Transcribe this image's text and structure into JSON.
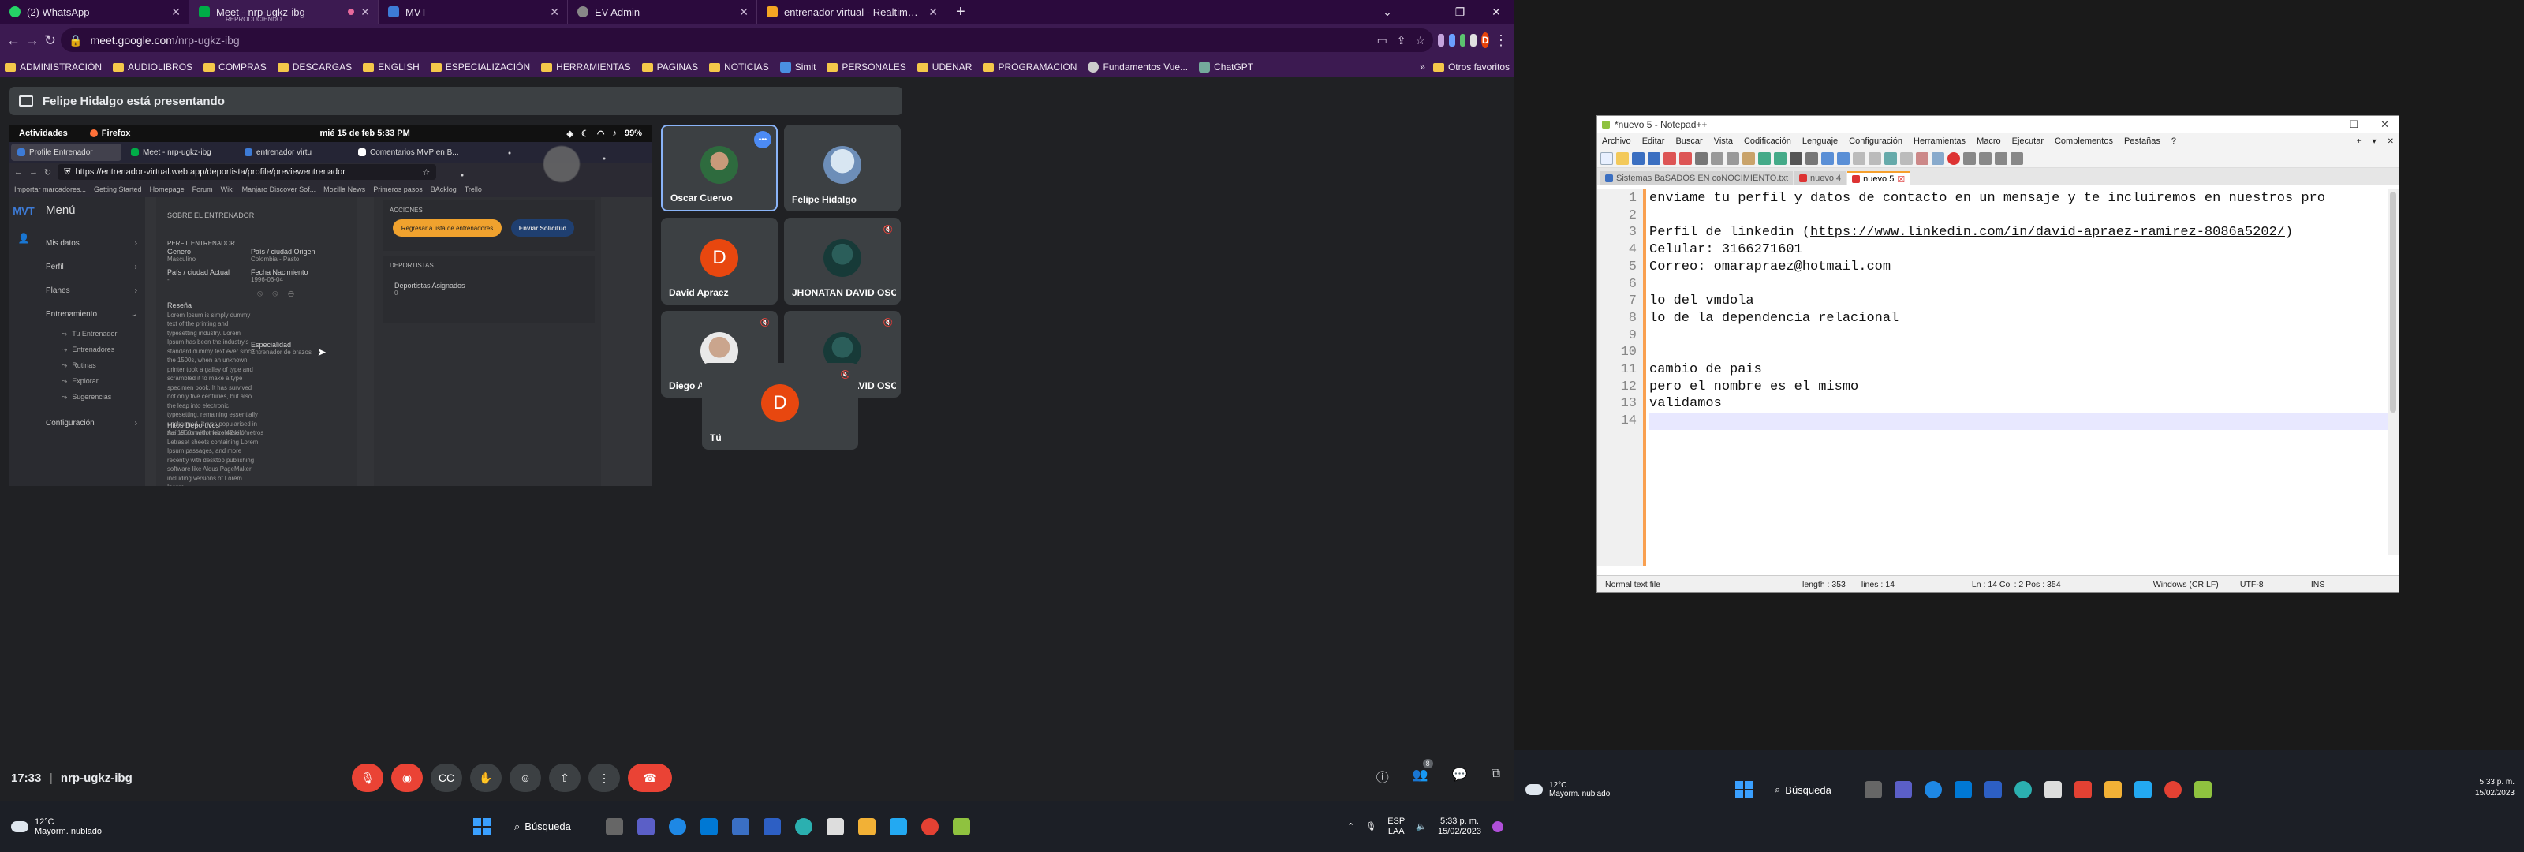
{
  "browser": {
    "tabs": [
      {
        "label": "(2) WhatsApp",
        "color": "#25d366"
      },
      {
        "label": "Meet - nrp-ugkz-ibg",
        "sublabel": "REPRODUCIENDO",
        "color": "#00ac47",
        "active": true
      },
      {
        "label": "MVT",
        "color": "#3d7bd6"
      },
      {
        "label": "EV Admin",
        "color": "#999999"
      },
      {
        "label": "entrenador virtual - Realtime Da",
        "color": "#f5a623"
      }
    ],
    "url": "meet.google.com",
    "url_path": "/nrp-ugkz-ibg",
    "bookmarks": [
      "ADMINISTRACIÓN",
      "AUDIOLIBROS",
      "COMPRAS",
      "DESCARGAS",
      "ENGLISH",
      "ESPECIALIZACIÓN",
      "HERRAMIENTAS",
      "PAGINAS",
      "NOTICIAS",
      "Simit",
      "PERSONALES",
      "UDENAR",
      "PROGRAMACION",
      "Fundamentos Vue...",
      "ChatGPT"
    ],
    "bookmarks_more": "»",
    "other_bookmarks": "Otros favoritos",
    "profile_initial": "D"
  },
  "meet": {
    "presenting": "Felipe Hidalgo está presentando",
    "time": "17:33",
    "code": "nrp-ugkz-ibg",
    "people_count": "8",
    "participants": [
      {
        "name": "Oscar Cuervo",
        "type": "photo",
        "speaking": true
      },
      {
        "name": "Felipe Hidalgo",
        "type": "photo"
      },
      {
        "name": "David Apraez",
        "type": "letter",
        "letter": "D"
      },
      {
        "name": "JHONATAN DAVID OSORIO LI...",
        "type": "photo",
        "muted": true
      },
      {
        "name": "Diego Agreda",
        "type": "photo",
        "muted": true
      },
      {
        "name": "JHONATAN DAVID OSORIO LI...",
        "type": "photo",
        "muted": true
      },
      {
        "name": "Tú",
        "type": "letter",
        "letter": "D",
        "muted": true
      }
    ]
  },
  "shared": {
    "activities": "Actividades",
    "firefox": "Firefox",
    "clock": "mié 15 de feb  5:33 PM",
    "battery": "99%",
    "tabs": [
      "Profile Entrenador",
      "Meet - nrp-ugkz-ibg",
      "entrenador virtu",
      "Comentarios MVP en B..."
    ],
    "url": "https://entrenador-virtual.web.app/deportista/profile/previewentrenador",
    "bookmarks": [
      "Importar marcadores...",
      "Getting Started",
      "Homepage",
      "Forum",
      "Wiki",
      "Manjaro Discover Sof...",
      "Mozilla News",
      "Primeros pasos",
      "BAcklog",
      "Trello"
    ],
    "app": {
      "logo": "MVT",
      "menu_title": "Menú",
      "menu": [
        "Mis datos",
        "Perfil",
        "Planes"
      ],
      "training": "Entrenamiento",
      "training_sub": [
        "Tu Entrenador",
        "Entrenadores",
        "Rutinas",
        "Explorar",
        "Sugerencias"
      ],
      "config": "Configuración",
      "about": "SOBRE EL ENTRENADOR",
      "profile_h": "PERFIL ENTRENADOR",
      "genero_k": "Genero",
      "genero_v": "Masculino",
      "pais_origen_k": "País / ciudad Origen",
      "pais_origen_v": "Colombia - Pasto",
      "pais_actual_k": "País / ciudad Actual",
      "pais_actual_v": "-",
      "fecha_k": "Fecha Nacimiento",
      "fecha_v": "1996-06-04",
      "resena_k": "Reseña",
      "resena_v": "Lorem Ipsum is simply dummy text of the printing and typesetting industry. Lorem Ipsum has been the industry's standard dummy text ever since the 1500s, when an unknown printer took a galley of type and scrambled it to make a type specimen book. It has survived not only five centuries, but also the leap into electronic typesetting, remaining essentially unchanged. It was popularised in the 1960s with the release of Letraset sheets containing Lorem Ipsum passages, and more recently with desktop publishing software like Aldus PageMaker including versions of Lorem Ipsum",
      "especialidad_k": "Especialidad",
      "especialidad_v": "Entrenador de brazos",
      "hitos_k": "Hitos Deportivos",
      "hitos_v": "Así, el comedor hizo 42 kilómetros",
      "acciones": "ACCIONES",
      "btn_return": "Regresar a lista de entrenadores",
      "btn_send": "Enviar Solicitud",
      "deportistas": "DEPORTISTAS",
      "asignados_k": "Deportistas Asignados",
      "asignados_v": "0"
    }
  },
  "taskbar_left": {
    "temp": "12°C",
    "weather": "Mayorm. nublado",
    "search": "Búsqueda",
    "lang1": "ESP",
    "lang2": "LAA",
    "time": "5:33 p. m.",
    "date": "15/02/2023"
  },
  "notepad": {
    "title": "*nuevo 5 - Notepad++",
    "menu": [
      "Archivo",
      "Editar",
      "Buscar",
      "Vista",
      "Codificación",
      "Lenguaje",
      "Configuración",
      "Herramientas",
      "Macro",
      "Ejecutar",
      "Complementos",
      "Pestañas",
      "?"
    ],
    "tabs": [
      "Sistemas BaSADOS EN coNOCIMIENTO.txt",
      "nuevo 4",
      "nuevo 5"
    ],
    "lines": [
      "enviame tu perfil y datos de contacto en un mensaje y te incluiremos en nuestros pro",
      "",
      "Perfil de linkedin (https://www.linkedin.com/in/david-apraez-ramirez-8086a5202/)",
      "Celular: 3166271601",
      "Correo: omarapraez@hotmail.com",
      "",
      "lo del vmdola",
      "lo de la dependencia relacional",
      "",
      "",
      "cambio de pais",
      "pero el nombre es el mismo",
      "validamos",
      ""
    ],
    "status": {
      "type": "Normal text file",
      "length": "length : 353",
      "lines": "lines : 14",
      "pos": "Ln : 14    Col : 2    Pos : 354",
      "eol": "Windows (CR LF)",
      "enc": "UTF-8",
      "ins": "INS"
    }
  },
  "taskbar_right": {
    "temp": "12°C",
    "weather": "Mayorm. nublado",
    "search": "Búsqueda",
    "time": "5:33 p. m.",
    "date": "15/02/2023"
  }
}
